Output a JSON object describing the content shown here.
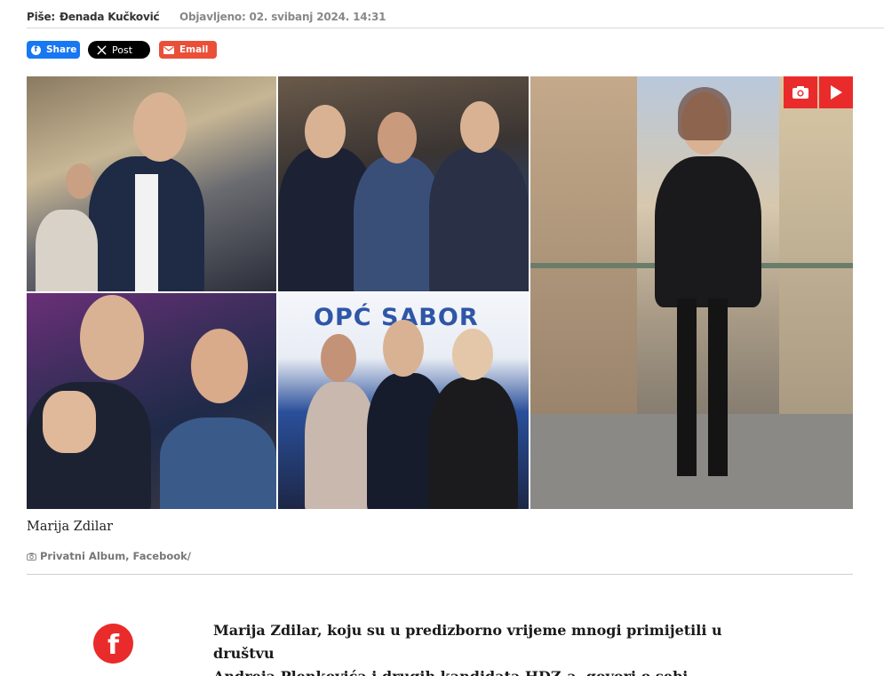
{
  "meta": {
    "author_prefix": "Piše:",
    "author_name": "Đenada Kučković",
    "published": "Objavljeno: 02. svibanj 2024. 14:31"
  },
  "share": {
    "facebook_label": "Share",
    "x_label": "Post",
    "email_label": "Email"
  },
  "gallery": {
    "banner_text": "OPĆ SABOR",
    "badge_icons": [
      "camera-icon",
      "play-icon"
    ]
  },
  "caption": "Marija Zdilar",
  "credit": "Privatni Album, Facebook/",
  "related": {
    "icon": "facebook-icon",
    "line1": "Marija Zdilar, koju su u predizborno vrijeme mnogi primijetili u društvu",
    "line2": "Andreja Plenkovića i drugih kandidata HDZ-a, govori o sebi"
  },
  "colors": {
    "brand_red": "#ea2b2b",
    "facebook_blue": "#1877f2",
    "email_orange": "#ea4f38"
  }
}
